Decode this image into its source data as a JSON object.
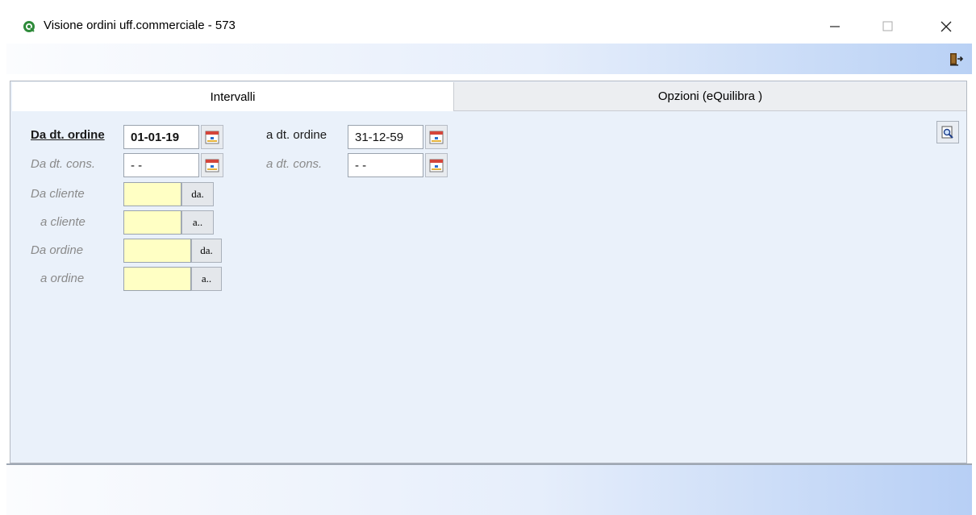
{
  "window": {
    "title": "Visione ordini uff.commerciale - 573",
    "controls": [
      "minimize",
      "maximize",
      "close"
    ]
  },
  "toolbar": {
    "icons": [
      "exit-door-icon"
    ]
  },
  "tabs": [
    {
      "label": "Intervalli",
      "active": true
    },
    {
      "label": "Opzioni (eQuilibra )",
      "active": false
    }
  ],
  "form": {
    "da_dt_ordine": {
      "label": "Da dt. ordine",
      "value": "01-01-19"
    },
    "a_dt_ordine": {
      "label": "a dt. ordine",
      "value": "31-12-59"
    },
    "da_dt_cons": {
      "label": "Da dt. cons.",
      "value": "- -"
    },
    "a_dt_cons": {
      "label": "a dt. cons.",
      "value": "- -"
    },
    "da_cliente": {
      "label": "Da cliente",
      "value": "",
      "button": "da."
    },
    "a_cliente": {
      "label": "a cliente",
      "value": "",
      "button": "a.."
    },
    "da_ordine": {
      "label": "Da ordine",
      "value": "",
      "button": "da."
    },
    "a_ordine": {
      "label": "a ordine",
      "value": "",
      "button": "a.."
    }
  },
  "colors": {
    "panel_bg": "#eaf1fa",
    "required_field_bg": "#ffffc4",
    "toolbar_gradient_end": "#b9d1f5"
  }
}
